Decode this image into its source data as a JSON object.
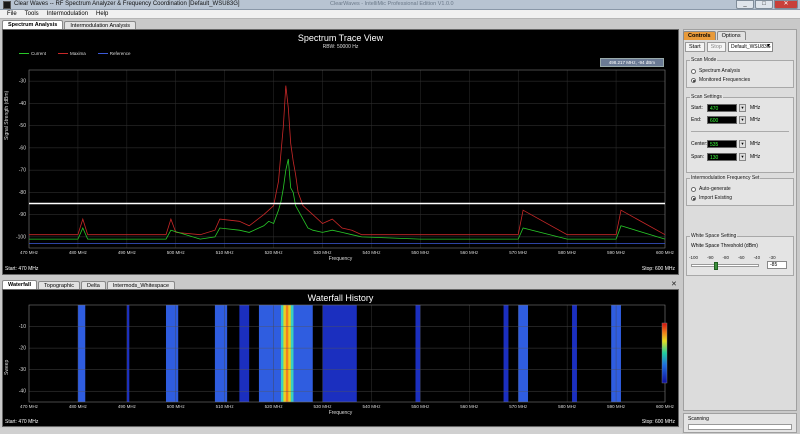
{
  "window": {
    "title": "Clear Waves -- RF Spectrum Analyzer & Frequency Coordination [Default_WSU83G]",
    "faint_title": "ClearWaves - IntelliMic Professional Edition V1.0.0",
    "minimize": "_",
    "maximize": "□",
    "close": "✕"
  },
  "menu": [
    "File",
    "Tools",
    "Intermodulation",
    "Help"
  ],
  "main_tabs": [
    "Spectrum Analysis",
    "Intermodulation Analysis"
  ],
  "spectrum": {
    "title": "Spectrum Trace View",
    "subtitle": "RBW: 50000 Hz",
    "legend": [
      {
        "name": "Current",
        "color": "#28c828"
      },
      {
        "name": "Maxima",
        "color": "#c82828"
      },
      {
        "name": "Reference",
        "color": "#3c5ad8"
      }
    ],
    "readout": "498.217 MHz, -94 dBm",
    "ylabel": "Signal Strength (dBm)",
    "xlabel": "Frequency",
    "start": "Start: 470 MHz",
    "stop": "Stop: 600 MHz",
    "threshold_dbm": -85
  },
  "bottom_tabs": [
    "Waterfall",
    "Topographic",
    "Delta",
    "Intermods_Whitespace"
  ],
  "close_panel": "✕",
  "waterfall": {
    "title": "Waterfall History",
    "ylabel": "Sweep",
    "xlabel": "Frequency",
    "start": "Start: 470 MHz",
    "stop": "Stop: 600 MHz"
  },
  "chart_data": [
    {
      "type": "line",
      "title": "Spectrum Trace View",
      "subtitle": "RBW: 50000 Hz",
      "xlabel": "Frequency",
      "ylabel": "Signal Strength (dBm)",
      "xlim": [
        470,
        600
      ],
      "ylim": [
        -105,
        -25
      ],
      "x_ticks": [
        "470 MHz",
        "480 MHz",
        "490 MHz",
        "500 MHz",
        "510 MHz",
        "520 MHz",
        "530 MHz",
        "540 MHz",
        "550 MHz",
        "560 MHz",
        "570 MHz",
        "580 MHz",
        "590 MHz",
        "600 MHz"
      ],
      "y_ticks": [
        -30,
        -40,
        -50,
        -60,
        -70,
        -80,
        -90,
        -100
      ],
      "grid": true,
      "legend": "top-left",
      "series": [
        {
          "name": "Current",
          "color": "#28c828",
          "x": [
            470,
            480,
            481,
            482,
            490,
            498,
            499,
            505,
            508,
            509,
            513,
            515,
            518,
            519,
            520,
            521,
            521.5,
            522,
            522.5,
            523,
            523.5,
            524,
            524.5,
            525,
            526,
            527,
            528,
            530,
            532,
            534,
            536,
            538,
            550,
            561,
            570,
            571,
            580,
            585,
            590,
            591,
            600
          ],
          "y": [
            -101,
            -101,
            -96,
            -101,
            -101,
            -101,
            -97,
            -101,
            -100,
            -96,
            -97,
            -98,
            -95,
            -93,
            -94,
            -88,
            -84,
            -78,
            -70,
            -65,
            -78,
            -80,
            -86,
            -88,
            -92,
            -96,
            -97,
            -98,
            -97,
            -98,
            -99,
            -100,
            -101,
            -101,
            -101,
            -96,
            -101,
            -101,
            -101,
            -95,
            -101
          ]
        },
        {
          "name": "Maxima",
          "color": "#c82828",
          "x": [
            470,
            480,
            481,
            482,
            490,
            498,
            499,
            500,
            505,
            508,
            509,
            513,
            515,
            518,
            519,
            520,
            521,
            521.5,
            522,
            522.5,
            523,
            523.5,
            524,
            524.5,
            525,
            526,
            527,
            528,
            530,
            532,
            534,
            536,
            538,
            550,
            561,
            570,
            571,
            580,
            585,
            590,
            591,
            600
          ],
          "y": [
            -99,
            -99,
            -92,
            -99,
            -99,
            -99,
            -92,
            -98,
            -99,
            -97,
            -92,
            -93,
            -95,
            -90,
            -88,
            -86,
            -75,
            -62,
            -50,
            -32,
            -42,
            -58,
            -66,
            -72,
            -80,
            -86,
            -88,
            -90,
            -94,
            -92,
            -96,
            -97,
            -99,
            -99,
            -99,
            -99,
            -88,
            -99,
            -99,
            -99,
            -88,
            -99
          ]
        },
        {
          "name": "Reference",
          "color": "#3c5ad8",
          "x": [
            470,
            600
          ],
          "y": [
            -103,
            -103
          ]
        }
      ]
    },
    {
      "type": "heatmap",
      "title": "Waterfall History",
      "xlabel": "Frequency",
      "ylabel": "Sweep",
      "xlim": [
        470,
        600
      ],
      "ylim": [
        -45,
        0
      ],
      "x_ticks": [
        "470 MHz",
        "480 MHz",
        "490 MHz",
        "500 MHz",
        "510 MHz",
        "520 MHz",
        "530 MHz",
        "540 MHz",
        "550 MHz",
        "560 MHz",
        "570 MHz",
        "580 MHz",
        "590 MHz",
        "600 MHz"
      ],
      "y_ticks": [
        -40,
        -30,
        -20,
        -10
      ],
      "active_bands": [
        {
          "from": 480,
          "to": 481.5,
          "level": "medium"
        },
        {
          "from": 490,
          "to": 490.5,
          "level": "low"
        },
        {
          "from": 498,
          "to": 500.5,
          "level": "medium"
        },
        {
          "from": 508,
          "to": 510.5,
          "level": "medium"
        },
        {
          "from": 513,
          "to": 515,
          "level": "low"
        },
        {
          "from": 517,
          "to": 528,
          "level": "medium"
        },
        {
          "from": 521.5,
          "to": 524,
          "level": "high"
        },
        {
          "from": 530,
          "to": 537,
          "level": "low"
        },
        {
          "from": 549,
          "to": 550,
          "level": "low"
        },
        {
          "from": 567,
          "to": 568,
          "level": "low"
        },
        {
          "from": 570,
          "to": 572,
          "level": "medium"
        },
        {
          "from": 581,
          "to": 582,
          "level": "low"
        },
        {
          "from": 589,
          "to": 591,
          "level": "medium"
        }
      ]
    }
  ],
  "right_tabs": [
    "Controls",
    "Options"
  ],
  "controls": {
    "start": "Start",
    "stop": "Stop",
    "profile": "Default_WSU83G",
    "scan_mode": {
      "title": "Scan Mode",
      "options": [
        "Spectrum Analysis",
        "Monitored Frequencies"
      ],
      "selected": 1
    },
    "scan_settings": {
      "title": "Scan Settings",
      "start_label": "Start:",
      "start_value": "470",
      "start_unit": "MHz",
      "end_label": "End:",
      "end_value": "600",
      "end_unit": "MHz",
      "center_label": "Center:",
      "center_value": "535",
      "center_unit": "MHz",
      "span_label": "Span:",
      "span_value": "130",
      "span_unit": "MHz"
    },
    "intermod": {
      "title": "Intermodulation Frequency Set",
      "options": [
        "Auto-generate",
        "Import Existing"
      ],
      "selected": 1
    },
    "whitespace": {
      "title": "White Space Setting",
      "label": "White Space Threshold (dBm)",
      "scale": [
        "-100",
        "-90",
        "-80",
        "-60",
        "-40",
        "-30"
      ],
      "value": "-85",
      "slider_fraction": 0.32
    },
    "status_label": "Scanning"
  }
}
